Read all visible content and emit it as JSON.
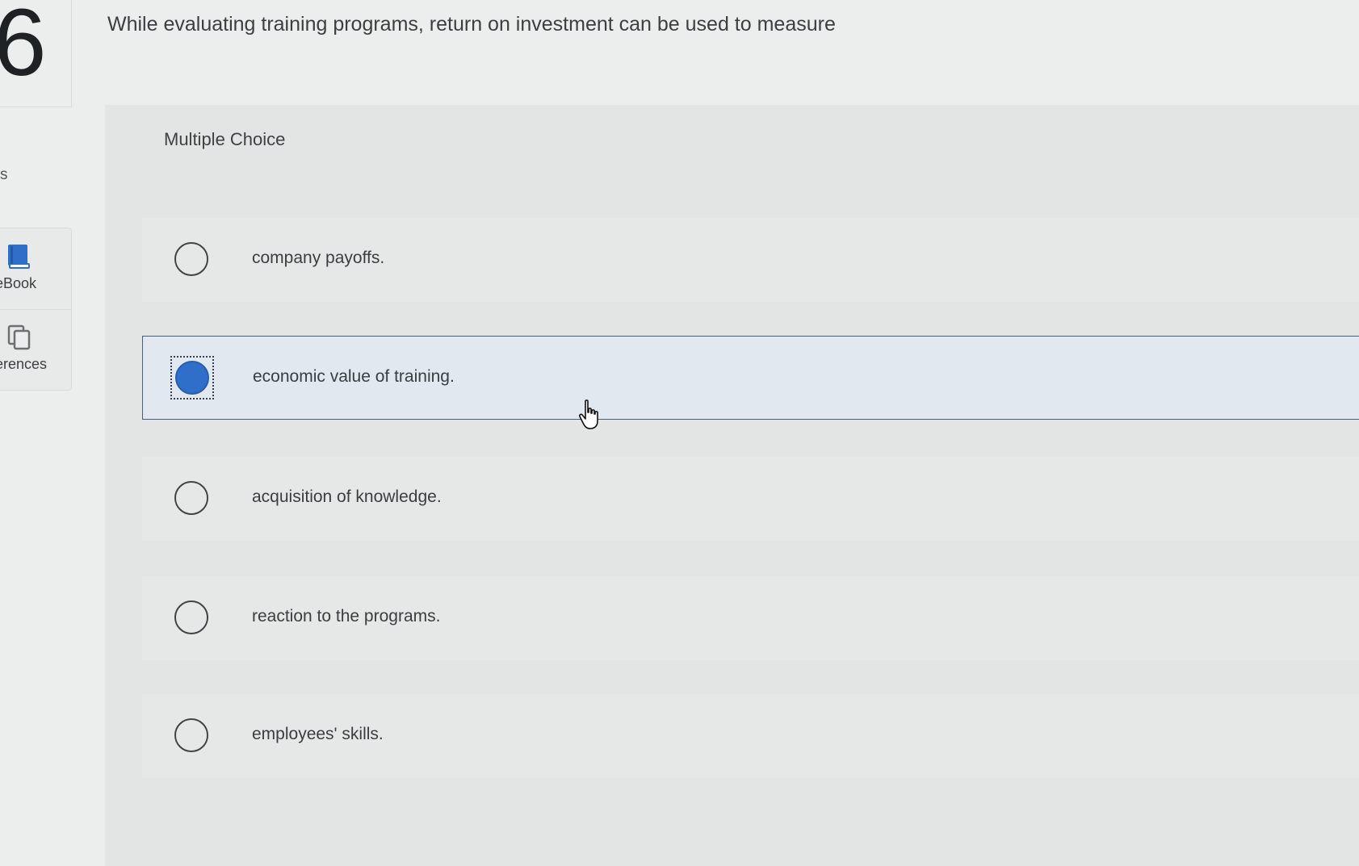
{
  "question": {
    "number": "6",
    "text": "While evaluating training programs, return on investment can be used to measure"
  },
  "rail": {
    "partial_label": "s",
    "tools": [
      {
        "label": "eBook",
        "icon": "book-icon"
      },
      {
        "label": "erences",
        "icon": "copy-icon"
      }
    ]
  },
  "choice": {
    "type_label": "Multiple Choice",
    "options": [
      {
        "text": "company payoffs.",
        "selected": false
      },
      {
        "text": "economic value of training.",
        "selected": true
      },
      {
        "text": "acquisition of knowledge.",
        "selected": false
      },
      {
        "text": "reaction to the programs.",
        "selected": false
      },
      {
        "text": "employees' skills.",
        "selected": false
      }
    ]
  },
  "colors": {
    "accent": "#2f6fc9",
    "selected_row_bg": "#e1e8ef",
    "selected_row_border": "#4a5f7a"
  }
}
